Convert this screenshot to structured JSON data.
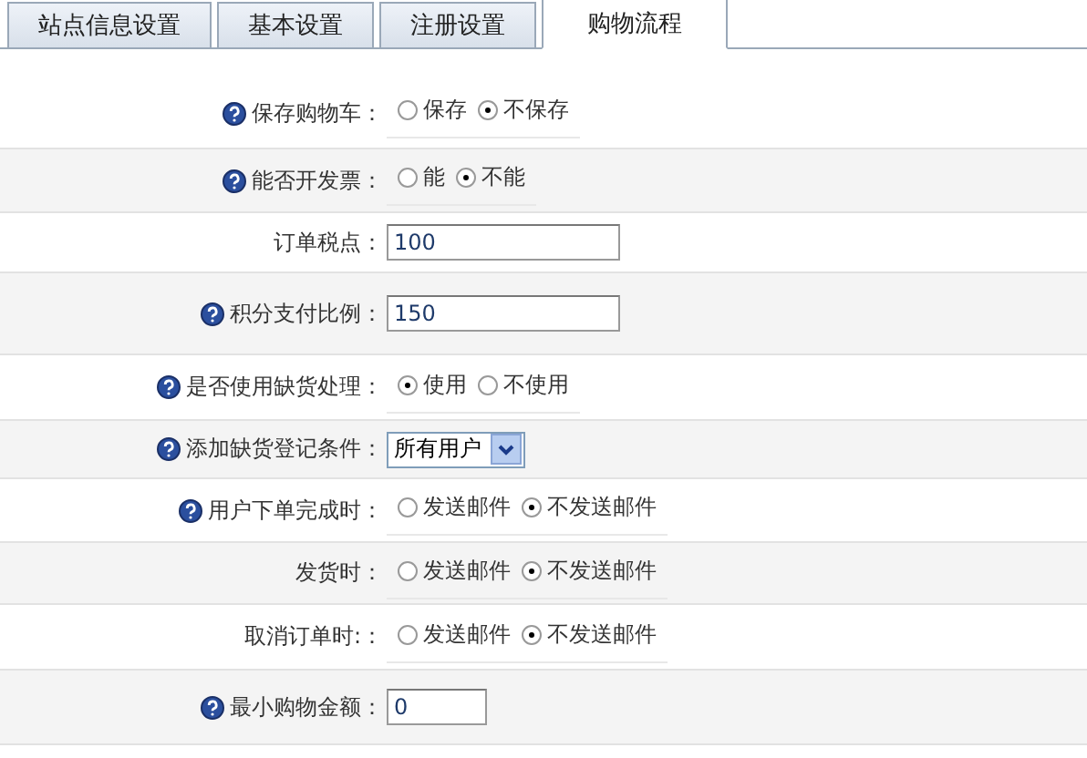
{
  "tabs": [
    {
      "label": "站点信息设置",
      "selected": false
    },
    {
      "label": "基本设置",
      "selected": false
    },
    {
      "label": "注册设置",
      "selected": false
    },
    {
      "label": "购物流程",
      "selected": true
    }
  ],
  "rows": [
    {
      "kind": "radio",
      "help": true,
      "label": "保存购物车：",
      "options": [
        {
          "label": "保存",
          "selected": false
        },
        {
          "label": "不保存",
          "selected": true
        }
      ]
    },
    {
      "kind": "radio",
      "help": true,
      "label": "能否开发票：",
      "options": [
        {
          "label": "能",
          "selected": false
        },
        {
          "label": "不能",
          "selected": true
        }
      ]
    },
    {
      "kind": "text",
      "help": false,
      "label": "订单税点：",
      "value": "100"
    },
    {
      "kind": "text",
      "help": true,
      "label": "积分支付比例：",
      "value": "150"
    },
    {
      "kind": "radio",
      "help": true,
      "label": "是否使用缺货处理：",
      "options": [
        {
          "label": "使用",
          "selected": true
        },
        {
          "label": "不使用",
          "selected": false
        }
      ]
    },
    {
      "kind": "select",
      "help": true,
      "label": "添加缺货登记条件：",
      "value": "所有用户"
    },
    {
      "kind": "radio",
      "help": true,
      "label": "用户下单完成时：",
      "options": [
        {
          "label": "发送邮件",
          "selected": false
        },
        {
          "label": "不发送邮件",
          "selected": true
        }
      ]
    },
    {
      "kind": "radio",
      "help": false,
      "label": "发货时：",
      "options": [
        {
          "label": "发送邮件",
          "selected": false
        },
        {
          "label": "不发送邮件",
          "selected": true
        }
      ]
    },
    {
      "kind": "radio",
      "help": false,
      "label": "取消订单时:：",
      "options": [
        {
          "label": "发送邮件",
          "selected": false
        },
        {
          "label": "不发送邮件",
          "selected": true
        }
      ]
    },
    {
      "kind": "small-text",
      "help": true,
      "label": "最小购物金额：",
      "value": "0"
    }
  ]
}
